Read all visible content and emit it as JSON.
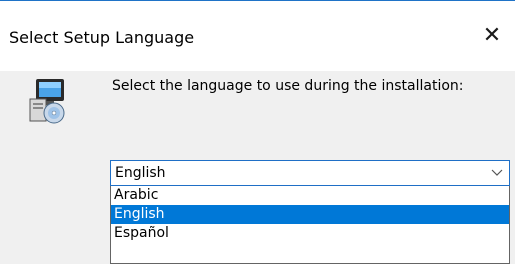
{
  "window": {
    "title": "Select Setup Language",
    "close_glyph": "✕"
  },
  "content": {
    "icon": "setup-computer-cd-icon",
    "prompt": "Select the language to use during the installation:"
  },
  "language_select": {
    "value": "English",
    "options": [
      "Arabic",
      "English",
      "Español"
    ],
    "highlighted": "English"
  },
  "colors": {
    "accent": "#0078d7",
    "focus_border": "#1f6fc6",
    "dialog_bg": "#f0f0f0"
  }
}
